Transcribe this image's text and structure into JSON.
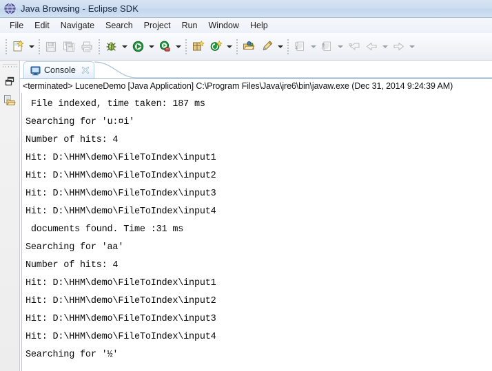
{
  "window": {
    "title": "Java Browsing - Eclipse SDK",
    "app_icon": "eclipse-globe-icon"
  },
  "menubar": {
    "items": [
      {
        "label": "File"
      },
      {
        "label": "Edit"
      },
      {
        "label": "Navigate"
      },
      {
        "label": "Search"
      },
      {
        "label": "Project"
      },
      {
        "label": "Run"
      },
      {
        "label": "Window"
      },
      {
        "label": "Help"
      }
    ]
  },
  "toolbar": {
    "groups": [
      {
        "buttons": [
          {
            "name": "new-wizard-button",
            "icon": "new-document-icon",
            "dropdown": true,
            "dropdown_dim": false
          }
        ]
      },
      {
        "buttons": [
          {
            "name": "save-button",
            "icon": "save-floppy-icon",
            "dropdown": false
          },
          {
            "name": "save-all-button",
            "icon": "save-all-icon",
            "dropdown": false
          },
          {
            "name": "print-button",
            "icon": "printer-icon",
            "dropdown": false
          }
        ]
      },
      {
        "buttons": [
          {
            "name": "debug-button",
            "icon": "debug-bug-icon",
            "dropdown": true,
            "dropdown_dim": false
          },
          {
            "name": "run-button",
            "icon": "run-play-icon",
            "dropdown": true,
            "dropdown_dim": false
          },
          {
            "name": "run-external-tools-button",
            "icon": "external-tools-icon",
            "dropdown": true,
            "dropdown_dim": false
          }
        ]
      },
      {
        "buttons": [
          {
            "name": "new-java-package-button",
            "icon": "java-package-icon",
            "dropdown": false
          },
          {
            "name": "new-java-class-button",
            "icon": "java-class-icon",
            "dropdown": true,
            "dropdown_dim": false
          }
        ]
      },
      {
        "buttons": [
          {
            "name": "open-type-button",
            "icon": "open-type-folder-icon",
            "dropdown": false
          },
          {
            "name": "search-button",
            "icon": "search-pen-icon",
            "dropdown": true,
            "dropdown_dim": false
          }
        ]
      },
      {
        "buttons": [
          {
            "name": "next-annotation-button",
            "icon": "next-annotation-icon",
            "dropdown": true,
            "dropdown_dim": true
          },
          {
            "name": "previous-annotation-button",
            "icon": "previous-annotation-icon",
            "dropdown": true,
            "dropdown_dim": true
          },
          {
            "name": "last-edit-location-button",
            "icon": "last-edit-location-icon",
            "dropdown": false
          },
          {
            "name": "back-button",
            "icon": "back-arrow-icon",
            "dropdown": true,
            "dropdown_dim": true
          },
          {
            "name": "forward-button",
            "icon": "forward-arrow-icon",
            "dropdown": true,
            "dropdown_dim": true
          }
        ]
      }
    ]
  },
  "left_rail": {
    "buttons": [
      {
        "name": "restore-view-button",
        "icon": "restore-window-icon"
      },
      {
        "name": "package-explorer-fastview-button",
        "icon": "package-explorer-folder-icon"
      }
    ]
  },
  "view": {
    "tab": {
      "label": "Console",
      "icon": "console-monitor-icon",
      "close_icon": "close-x-icon"
    },
    "header": "<terminated> LuceneDemo [Java Application] C:\\Program Files\\Java\\jre6\\bin\\javaw.exe (Dec 31, 2014 9:24:39 AM)"
  },
  "console": {
    "lines": [
      " File indexed, time taken: 187 ms",
      "Searching for 'u:¤i'",
      "Number of hits: 4",
      "Hit: D:\\HHM\\demo\\FileToIndex\\input1",
      "Hit: D:\\HHM\\demo\\FileToIndex\\input2",
      "Hit: D:\\HHM\\demo\\FileToIndex\\input3",
      "Hit: D:\\HHM\\demo\\FileToIndex\\input4",
      " documents found. Time :31 ms",
      "Searching for 'аа'",
      "Number of hits: 4",
      "Hit: D:\\HHM\\demo\\FileToIndex\\input1",
      "Hit: D:\\HHM\\demo\\FileToIndex\\input2",
      "Hit: D:\\HHM\\demo\\FileToIndex\\input3",
      "Hit: D:\\HHM\\demo\\FileToIndex\\input4",
      "Searching for '½'"
    ]
  },
  "colors": {
    "titlebar": "#cddef0",
    "toolbar": "#f2f4f8",
    "tab_active": "#e3eefa",
    "console_text": "#0a0a0a"
  }
}
